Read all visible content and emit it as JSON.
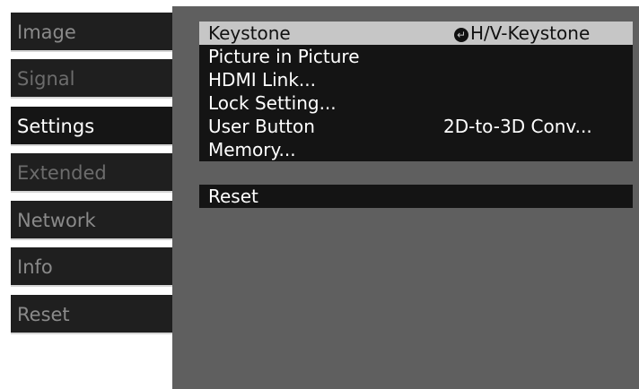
{
  "tabs": [
    {
      "label": "Image",
      "state": "normal"
    },
    {
      "label": "Signal",
      "state": "dim"
    },
    {
      "label": "Settings",
      "state": "active"
    },
    {
      "label": "Extended",
      "state": "dim"
    },
    {
      "label": "Network",
      "state": "normal"
    },
    {
      "label": "Info",
      "state": "normal"
    },
    {
      "label": "Reset",
      "state": "normal"
    }
  ],
  "menu": {
    "items": [
      {
        "label": "Keystone",
        "value": "H/V-Keystone",
        "icon": "enter-icon",
        "selected": true
      },
      {
        "label": "Picture in Picture",
        "value": ""
      },
      {
        "label": "HDMI Link...",
        "value": ""
      },
      {
        "label": "Lock Setting...",
        "value": ""
      },
      {
        "label": "User Button",
        "value": "2D-to-3D Conv..."
      },
      {
        "label": "Memory...",
        "value": ""
      }
    ],
    "reset_label": "Reset"
  },
  "colors": {
    "panel": "#5f5f5f",
    "row": "#141414",
    "selected_row": "#c6c6c6",
    "tab": "#1f1f1f"
  }
}
